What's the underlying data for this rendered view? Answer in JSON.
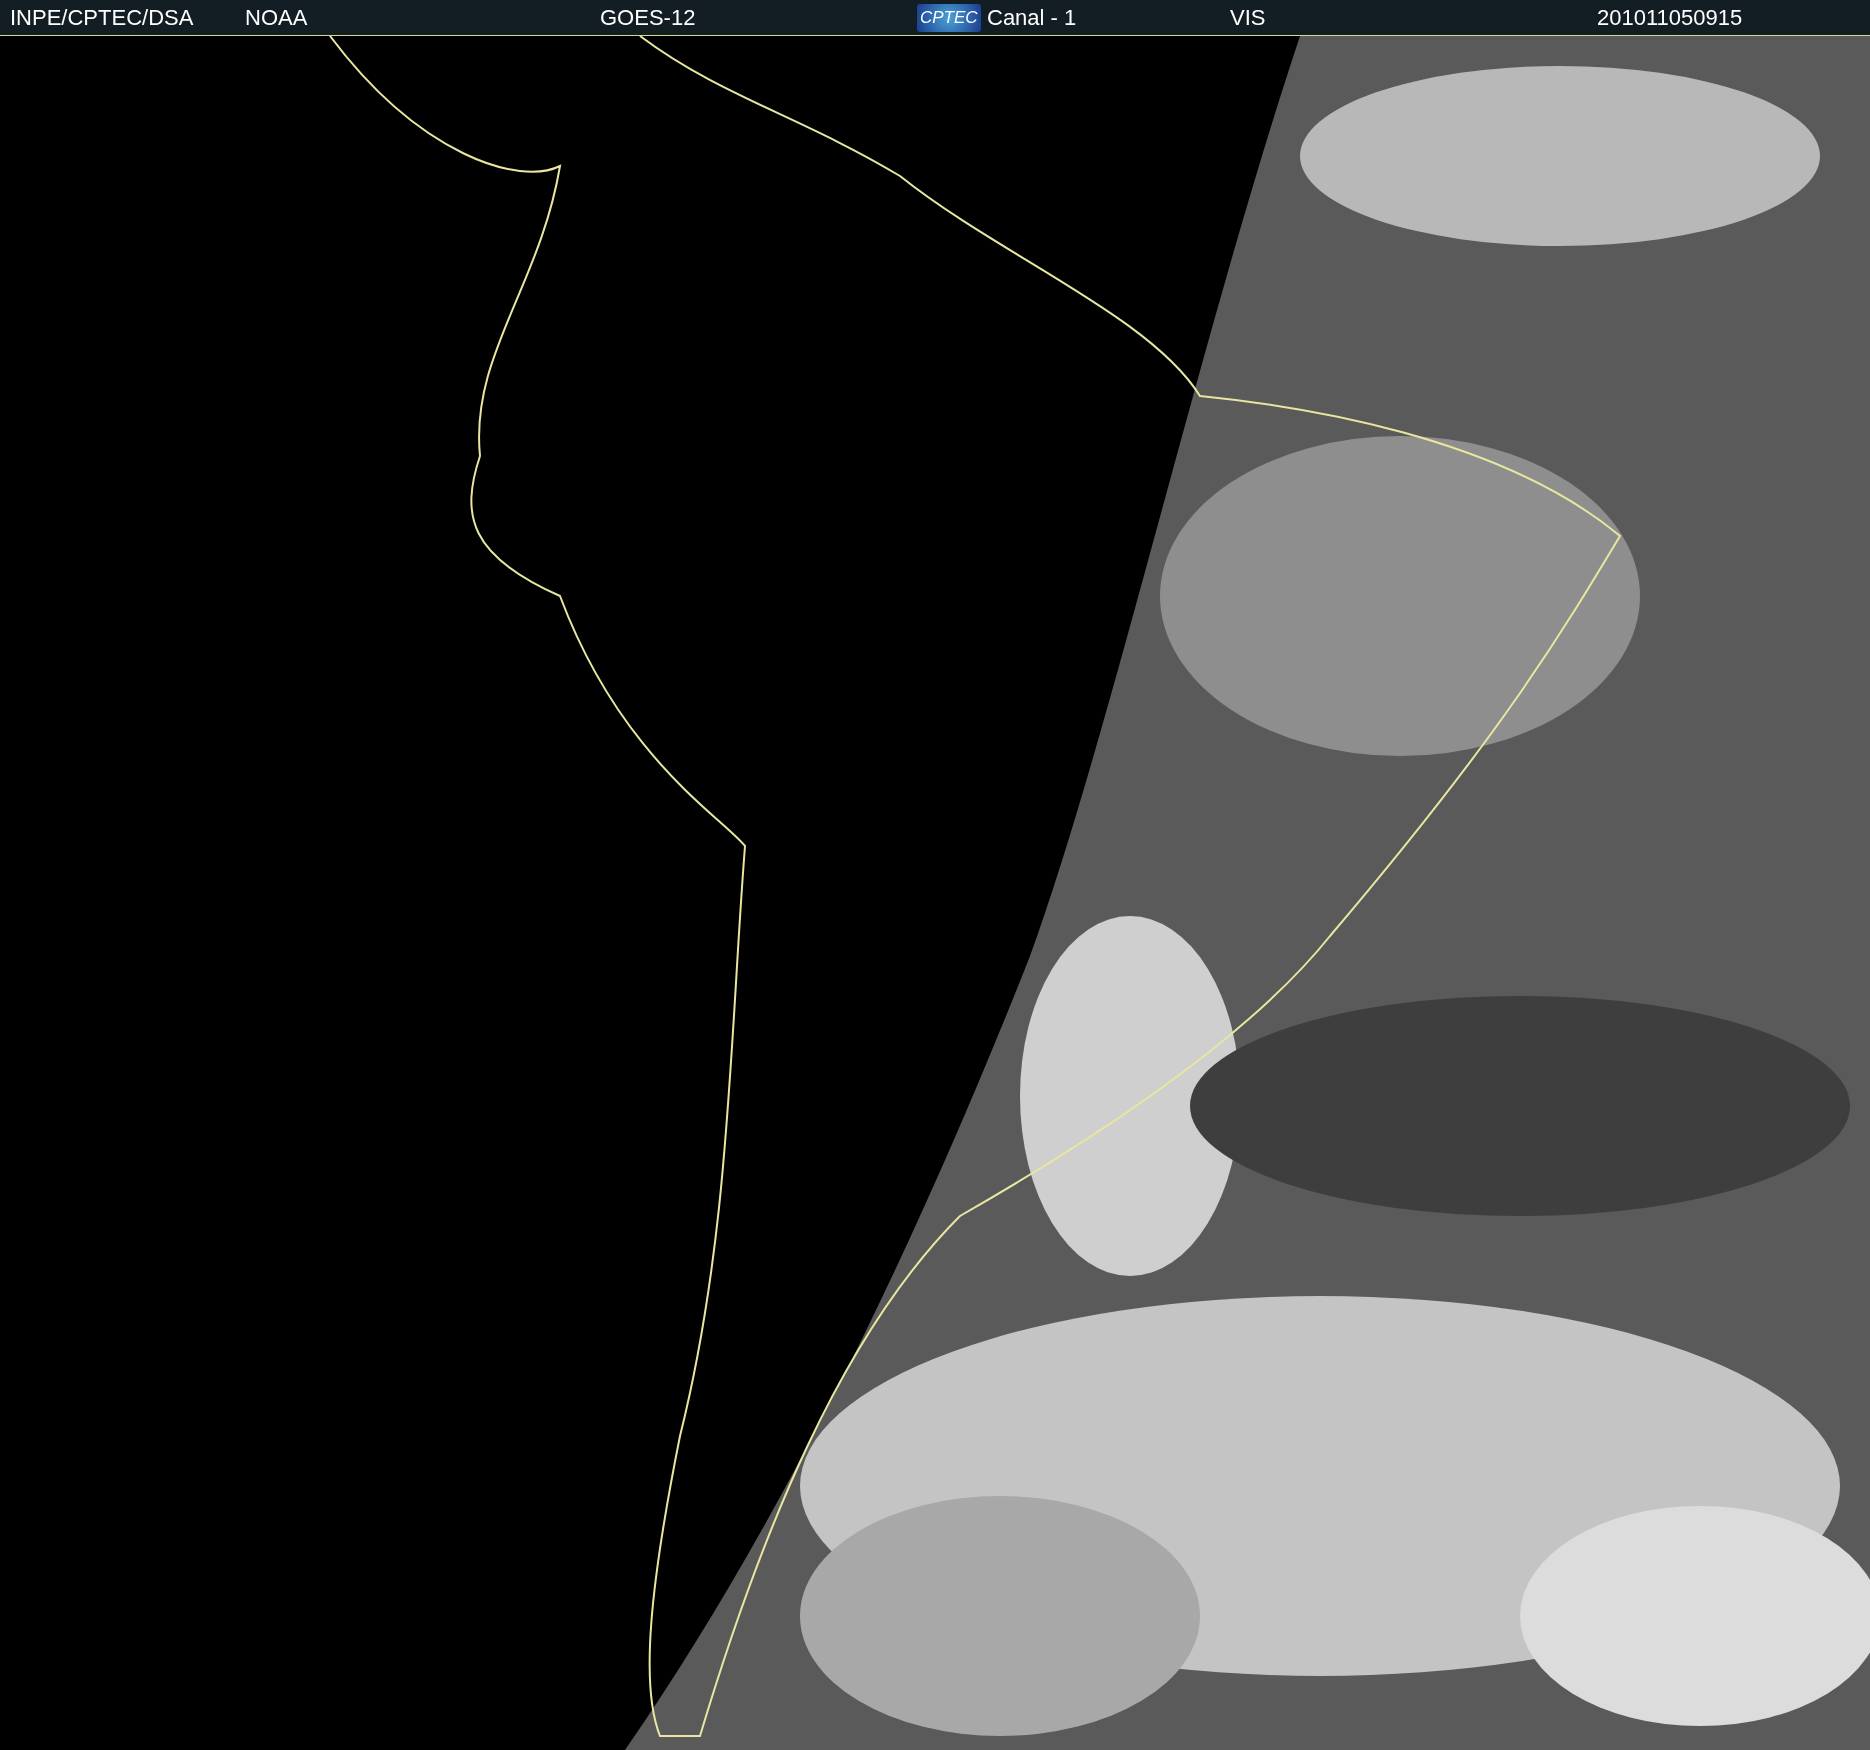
{
  "header": {
    "items": [
      {
        "kind": "text",
        "text": "INPE/CPTEC/DSA"
      },
      {
        "kind": "text",
        "text": "NOAA"
      },
      {
        "kind": "text",
        "text": "GOES-12"
      },
      {
        "kind": "logo",
        "text": "CPTEC"
      },
      {
        "kind": "text",
        "text": "Canal - 1"
      },
      {
        "kind": "text",
        "text": "VIS"
      },
      {
        "kind": "text",
        "text": "201011050915"
      }
    ]
  }
}
